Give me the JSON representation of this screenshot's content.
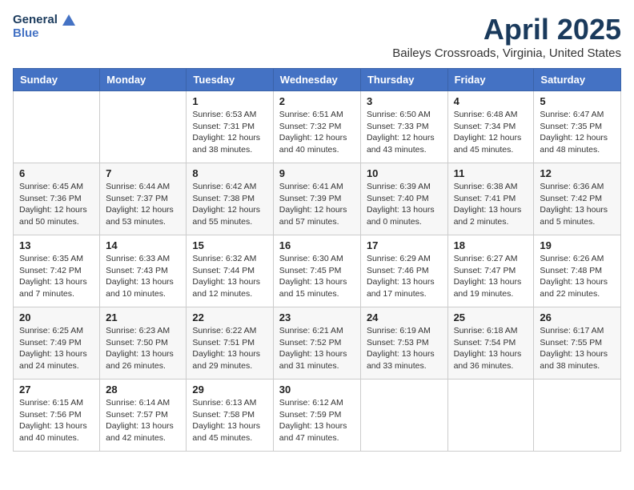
{
  "logo": {
    "line1": "General",
    "line2": "Blue"
  },
  "title": "April 2025",
  "location": "Baileys Crossroads, Virginia, United States",
  "weekdays": [
    "Sunday",
    "Monday",
    "Tuesday",
    "Wednesday",
    "Thursday",
    "Friday",
    "Saturday"
  ],
  "weeks": [
    [
      {
        "day": "",
        "sunrise": "",
        "sunset": "",
        "daylight": ""
      },
      {
        "day": "",
        "sunrise": "",
        "sunset": "",
        "daylight": ""
      },
      {
        "day": "1",
        "sunrise": "Sunrise: 6:53 AM",
        "sunset": "Sunset: 7:31 PM",
        "daylight": "Daylight: 12 hours and 38 minutes."
      },
      {
        "day": "2",
        "sunrise": "Sunrise: 6:51 AM",
        "sunset": "Sunset: 7:32 PM",
        "daylight": "Daylight: 12 hours and 40 minutes."
      },
      {
        "day": "3",
        "sunrise": "Sunrise: 6:50 AM",
        "sunset": "Sunset: 7:33 PM",
        "daylight": "Daylight: 12 hours and 43 minutes."
      },
      {
        "day": "4",
        "sunrise": "Sunrise: 6:48 AM",
        "sunset": "Sunset: 7:34 PM",
        "daylight": "Daylight: 12 hours and 45 minutes."
      },
      {
        "day": "5",
        "sunrise": "Sunrise: 6:47 AM",
        "sunset": "Sunset: 7:35 PM",
        "daylight": "Daylight: 12 hours and 48 minutes."
      }
    ],
    [
      {
        "day": "6",
        "sunrise": "Sunrise: 6:45 AM",
        "sunset": "Sunset: 7:36 PM",
        "daylight": "Daylight: 12 hours and 50 minutes."
      },
      {
        "day": "7",
        "sunrise": "Sunrise: 6:44 AM",
        "sunset": "Sunset: 7:37 PM",
        "daylight": "Daylight: 12 hours and 53 minutes."
      },
      {
        "day": "8",
        "sunrise": "Sunrise: 6:42 AM",
        "sunset": "Sunset: 7:38 PM",
        "daylight": "Daylight: 12 hours and 55 minutes."
      },
      {
        "day": "9",
        "sunrise": "Sunrise: 6:41 AM",
        "sunset": "Sunset: 7:39 PM",
        "daylight": "Daylight: 12 hours and 57 minutes."
      },
      {
        "day": "10",
        "sunrise": "Sunrise: 6:39 AM",
        "sunset": "Sunset: 7:40 PM",
        "daylight": "Daylight: 13 hours and 0 minutes."
      },
      {
        "day": "11",
        "sunrise": "Sunrise: 6:38 AM",
        "sunset": "Sunset: 7:41 PM",
        "daylight": "Daylight: 13 hours and 2 minutes."
      },
      {
        "day": "12",
        "sunrise": "Sunrise: 6:36 AM",
        "sunset": "Sunset: 7:42 PM",
        "daylight": "Daylight: 13 hours and 5 minutes."
      }
    ],
    [
      {
        "day": "13",
        "sunrise": "Sunrise: 6:35 AM",
        "sunset": "Sunset: 7:42 PM",
        "daylight": "Daylight: 13 hours and 7 minutes."
      },
      {
        "day": "14",
        "sunrise": "Sunrise: 6:33 AM",
        "sunset": "Sunset: 7:43 PM",
        "daylight": "Daylight: 13 hours and 10 minutes."
      },
      {
        "day": "15",
        "sunrise": "Sunrise: 6:32 AM",
        "sunset": "Sunset: 7:44 PM",
        "daylight": "Daylight: 13 hours and 12 minutes."
      },
      {
        "day": "16",
        "sunrise": "Sunrise: 6:30 AM",
        "sunset": "Sunset: 7:45 PM",
        "daylight": "Daylight: 13 hours and 15 minutes."
      },
      {
        "day": "17",
        "sunrise": "Sunrise: 6:29 AM",
        "sunset": "Sunset: 7:46 PM",
        "daylight": "Daylight: 13 hours and 17 minutes."
      },
      {
        "day": "18",
        "sunrise": "Sunrise: 6:27 AM",
        "sunset": "Sunset: 7:47 PM",
        "daylight": "Daylight: 13 hours and 19 minutes."
      },
      {
        "day": "19",
        "sunrise": "Sunrise: 6:26 AM",
        "sunset": "Sunset: 7:48 PM",
        "daylight": "Daylight: 13 hours and 22 minutes."
      }
    ],
    [
      {
        "day": "20",
        "sunrise": "Sunrise: 6:25 AM",
        "sunset": "Sunset: 7:49 PM",
        "daylight": "Daylight: 13 hours and 24 minutes."
      },
      {
        "day": "21",
        "sunrise": "Sunrise: 6:23 AM",
        "sunset": "Sunset: 7:50 PM",
        "daylight": "Daylight: 13 hours and 26 minutes."
      },
      {
        "day": "22",
        "sunrise": "Sunrise: 6:22 AM",
        "sunset": "Sunset: 7:51 PM",
        "daylight": "Daylight: 13 hours and 29 minutes."
      },
      {
        "day": "23",
        "sunrise": "Sunrise: 6:21 AM",
        "sunset": "Sunset: 7:52 PM",
        "daylight": "Daylight: 13 hours and 31 minutes."
      },
      {
        "day": "24",
        "sunrise": "Sunrise: 6:19 AM",
        "sunset": "Sunset: 7:53 PM",
        "daylight": "Daylight: 13 hours and 33 minutes."
      },
      {
        "day": "25",
        "sunrise": "Sunrise: 6:18 AM",
        "sunset": "Sunset: 7:54 PM",
        "daylight": "Daylight: 13 hours and 36 minutes."
      },
      {
        "day": "26",
        "sunrise": "Sunrise: 6:17 AM",
        "sunset": "Sunset: 7:55 PM",
        "daylight": "Daylight: 13 hours and 38 minutes."
      }
    ],
    [
      {
        "day": "27",
        "sunrise": "Sunrise: 6:15 AM",
        "sunset": "Sunset: 7:56 PM",
        "daylight": "Daylight: 13 hours and 40 minutes."
      },
      {
        "day": "28",
        "sunrise": "Sunrise: 6:14 AM",
        "sunset": "Sunset: 7:57 PM",
        "daylight": "Daylight: 13 hours and 42 minutes."
      },
      {
        "day": "29",
        "sunrise": "Sunrise: 6:13 AM",
        "sunset": "Sunset: 7:58 PM",
        "daylight": "Daylight: 13 hours and 45 minutes."
      },
      {
        "day": "30",
        "sunrise": "Sunrise: 6:12 AM",
        "sunset": "Sunset: 7:59 PM",
        "daylight": "Daylight: 13 hours and 47 minutes."
      },
      {
        "day": "",
        "sunrise": "",
        "sunset": "",
        "daylight": ""
      },
      {
        "day": "",
        "sunrise": "",
        "sunset": "",
        "daylight": ""
      },
      {
        "day": "",
        "sunrise": "",
        "sunset": "",
        "daylight": ""
      }
    ]
  ]
}
